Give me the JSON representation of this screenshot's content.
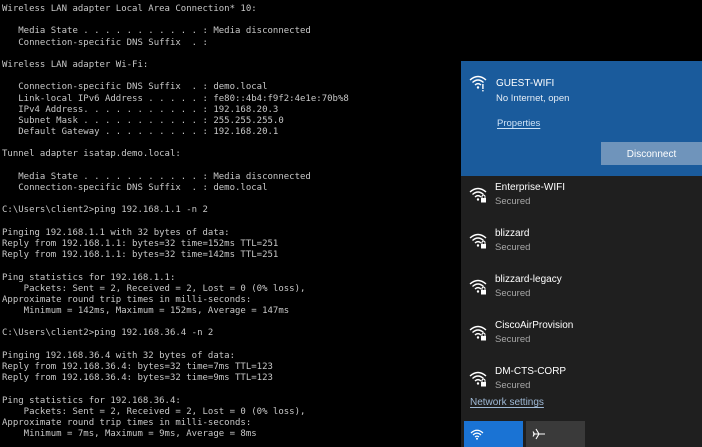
{
  "console": {
    "lines": [
      "Wireless LAN adapter Local Area Connection* 10:",
      "",
      "   Media State . . . . . . . . . . . : Media disconnected",
      "   Connection-specific DNS Suffix  . :",
      "",
      "Wireless LAN adapter Wi-Fi:",
      "",
      "   Connection-specific DNS Suffix  . : demo.local",
      "   Link-local IPv6 Address . . . . . : fe80::4b4:f9f2:4e1e:70b%8",
      "   IPv4 Address. . . . . . . . . . . : 192.168.20.3",
      "   Subnet Mask . . . . . . . . . . . : 255.255.255.0",
      "   Default Gateway . . . . . . . . . : 192.168.20.1",
      "",
      "Tunnel adapter isatap.demo.local:",
      "",
      "   Media State . . . . . . . . . . . : Media disconnected",
      "   Connection-specific DNS Suffix  . : demo.local",
      "",
      "C:\\Users\\client2>ping 192.168.1.1 -n 2",
      "",
      "Pinging 192.168.1.1 with 32 bytes of data:",
      "Reply from 192.168.1.1: bytes=32 time=152ms TTL=251",
      "Reply from 192.168.1.1: bytes=32 time=142ms TTL=251",
      "",
      "Ping statistics for 192.168.1.1:",
      "    Packets: Sent = 2, Received = 2, Lost = 0 (0% loss),",
      "Approximate round trip times in milli-seconds:",
      "    Minimum = 142ms, Maximum = 152ms, Average = 147ms",
      "",
      "C:\\Users\\client2>ping 192.168.36.4 -n 2",
      "",
      "Pinging 192.168.36.4 with 32 bytes of data:",
      "Reply from 192.168.36.4: bytes=32 time=7ms TTL=123",
      "Reply from 192.168.36.4: bytes=32 time=9ms TTL=123",
      "",
      "Ping statistics for 192.168.36.4:",
      "    Packets: Sent = 2, Received = 2, Lost = 0 (0% loss),",
      "Approximate round trip times in milli-seconds:",
      "    Minimum = 7ms, Maximum = 9ms, Average = 8ms"
    ]
  },
  "flyout": {
    "active": {
      "ssid": "GUEST-WIFI",
      "status": "No Internet, open",
      "properties_label": "Properties",
      "disconnect_label": "Disconnect",
      "icon": "wifi-warning-icon"
    },
    "networks": [
      {
        "name": "Enterprise-WIFI",
        "status": "Secured",
        "icon": "wifi-secured-icon"
      },
      {
        "name": "blizzard",
        "status": "Secured",
        "icon": "wifi-secured-icon"
      },
      {
        "name": "blizzard-legacy",
        "status": "Secured",
        "icon": "wifi-secured-icon"
      },
      {
        "name": "CiscoAirProvision",
        "status": "Secured",
        "icon": "wifi-secured-icon"
      },
      {
        "name": "DM-CTS-CORP",
        "status": "Secured",
        "icon": "wifi-secured-icon"
      }
    ],
    "network_settings_label": "Network settings",
    "tiles": [
      {
        "name": "wifi-tile",
        "icon": "wifi-icon"
      },
      {
        "name": "airplane-mode-tile",
        "icon": "airplane-icon"
      }
    ],
    "colors": {
      "active_bg": "#1a5b9c",
      "flyout_bg": "#1f1f1f",
      "disconnect_bg": "#6f94bb",
      "wifi_tile": "#1a73d4"
    }
  }
}
